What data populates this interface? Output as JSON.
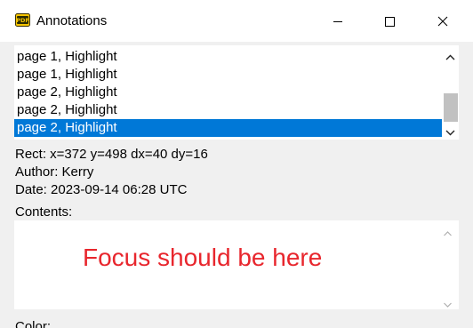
{
  "window": {
    "title": "Annotations",
    "icon": "pdf-app-icon",
    "controls": [
      "minimize-icon",
      "maximize-icon",
      "close-icon"
    ]
  },
  "annotation_list": {
    "items": [
      {
        "label": "page 1, Highlight",
        "selected": false
      },
      {
        "label": "page 1, Highlight",
        "selected": false
      },
      {
        "label": "page 2, Highlight",
        "selected": false
      },
      {
        "label": "page 2, Highlight",
        "selected": false
      },
      {
        "label": "page 2, Highlight",
        "selected": true
      }
    ]
  },
  "details": {
    "rect": "Rect: x=372 y=498 dx=40 dy=16",
    "author": "Author: Kerry",
    "date": "Date: 2023-09-14 06:28 UTC",
    "contents_label": "Contents:",
    "color_label": "Color:"
  },
  "contents": {
    "value": "Focus should be here"
  },
  "colors": {
    "selection": "#0078d7",
    "contents_text": "#e8262d",
    "window_bg": "#f0f0f0"
  }
}
